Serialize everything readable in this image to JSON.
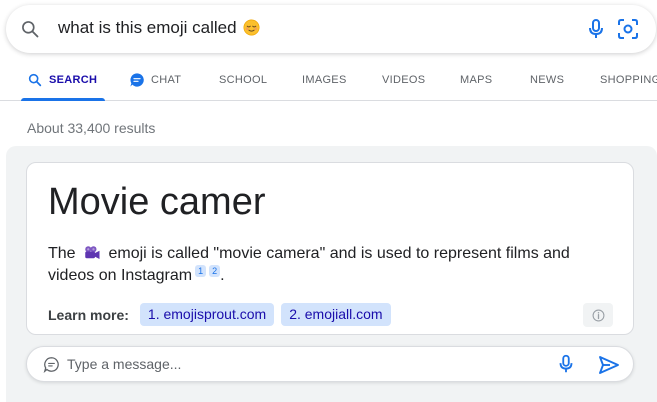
{
  "search": {
    "query": "what is this emoji called",
    "query_emoji": "relieved-face-emoji"
  },
  "tabs": [
    {
      "label": "SEARCH",
      "icon": "search-icon",
      "active": true
    },
    {
      "label": "CHAT",
      "icon": "chat-bubble-icon",
      "active": false
    },
    {
      "label": "SCHOOL",
      "active": false
    },
    {
      "label": "IMAGES",
      "active": false
    },
    {
      "label": "VIDEOS",
      "active": false
    },
    {
      "label": "MAPS",
      "active": false
    },
    {
      "label": "NEWS",
      "active": false
    },
    {
      "label": "SHOPPING",
      "active": false
    }
  ],
  "results_count": "About 33,400 results",
  "answer": {
    "title": "Movie camer",
    "text_before": "The",
    "emoji_icon": "movie-camera-emoji",
    "text_after": "emoji is called \"movie camera\" and is used to represent films and videos on Instagram",
    "citations": [
      "1",
      "2"
    ],
    "end_punct": ".",
    "learn_more_label": "Learn more:",
    "sources": [
      "1. emojisprout.com",
      "2. emojiall.com"
    ]
  },
  "chat": {
    "placeholder": "Type a message..."
  },
  "colors": {
    "accent": "#1a73e8",
    "chip_bg": "#d2e3fc",
    "panel_bg": "#f1f3f4"
  }
}
